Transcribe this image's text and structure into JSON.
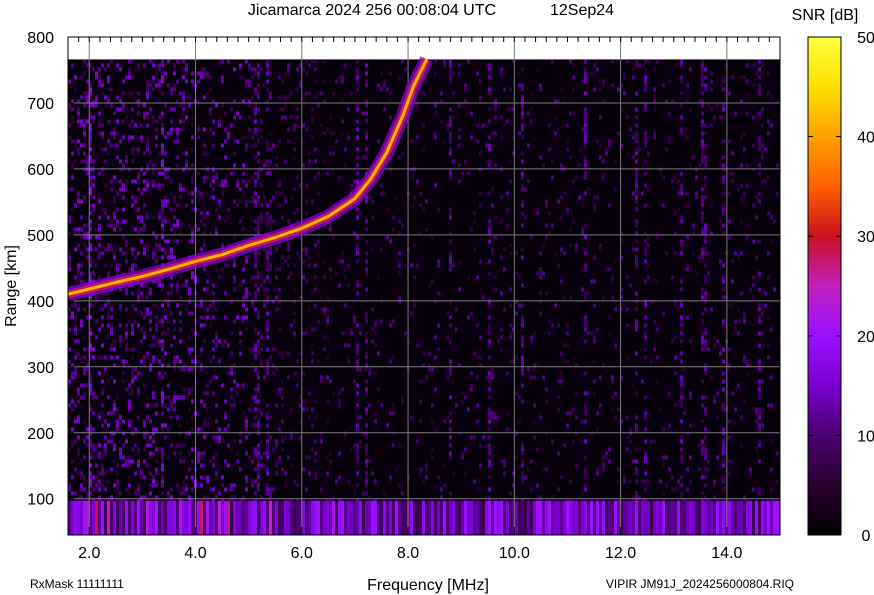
{
  "chart_data": {
    "type": "heatmap",
    "title": "Jicamarca 2024 256 00:08:04 UTC",
    "date_label": "12Sep24",
    "xlabel": "Frequency [MHz]",
    "ylabel": "Range [km]",
    "xlim": [
      1.6,
      15.0
    ],
    "ylim": [
      45,
      800
    ],
    "x_ticks": [
      2.0,
      4.0,
      6.0,
      8.0,
      10.0,
      12.0,
      14.0
    ],
    "x_tick_labels": [
      "2.0",
      "4.0",
      "6.0",
      "8.0",
      "10.0",
      "12.0",
      "14.0"
    ],
    "y_ticks": [
      100,
      200,
      300,
      400,
      500,
      600,
      700,
      800
    ],
    "y_tick_labels": [
      "100",
      "200",
      "300",
      "400",
      "500",
      "600",
      "700",
      "800"
    ],
    "grid": true,
    "colorbar": {
      "label": "SNR [dB]",
      "range": [
        0,
        50
      ],
      "ticks": [
        0,
        10,
        20,
        30,
        40,
        50
      ],
      "tick_labels": [
        "0",
        "10",
        "20",
        "30",
        "40",
        "50"
      ],
      "colors": [
        "#000000",
        "#2a0030",
        "#4a0070",
        "#7a00d0",
        "#9a10ff",
        "#c020c0",
        "#cc1020",
        "#ff6000",
        "#ffa000",
        "#ffe000",
        "#ffff40"
      ]
    },
    "data_extent_top_km": 766,
    "echo_trace": {
      "name": "",
      "points": [
        [
          1.6,
          410
        ],
        [
          2.0,
          418
        ],
        [
          2.5,
          428
        ],
        [
          3.0,
          437
        ],
        [
          3.5,
          448
        ],
        [
          4.0,
          460
        ],
        [
          4.5,
          470
        ],
        [
          5.0,
          484
        ],
        [
          5.5,
          496
        ],
        [
          6.0,
          510
        ],
        [
          6.5,
          528
        ],
        [
          7.0,
          555
        ],
        [
          7.3,
          585
        ],
        [
          7.6,
          625
        ],
        [
          7.9,
          680
        ],
        [
          8.1,
          725
        ],
        [
          8.35,
          766
        ]
      ],
      "peak_snr_db": 42
    },
    "ground_clutter_band": {
      "range_km": [
        45,
        97
      ],
      "snr_db": 20
    }
  },
  "footer": {
    "rx_mask": "RxMask 11111111",
    "file_info": "VIPIR  JM91J_2024256000804.RIQ"
  }
}
